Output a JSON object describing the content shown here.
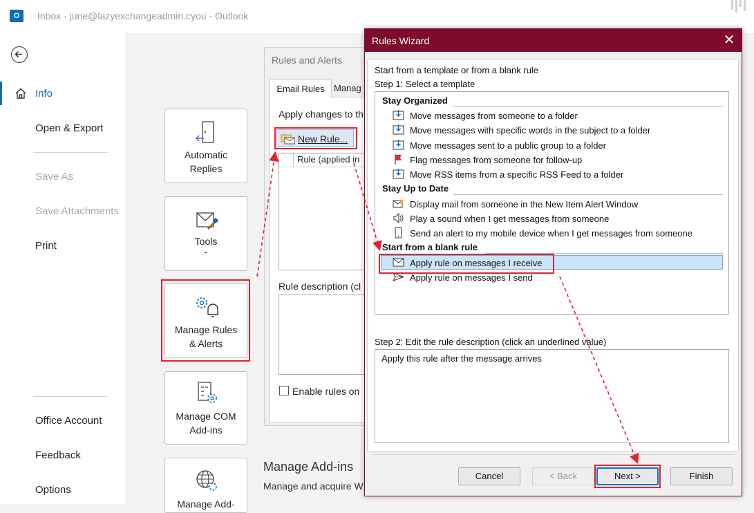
{
  "window": {
    "title": "Inbox - june@lazyexchangeadmin.cyou  -  Outlook",
    "app_icon": "outlook-icon"
  },
  "nav": {
    "info": "Info",
    "open_export": "Open & Export",
    "save_as": "Save As",
    "save_attachments": "Save Attachments",
    "print": "Print",
    "office_account": "Office Account",
    "feedback": "Feedback",
    "options": "Options"
  },
  "tiles": {
    "automatic_replies": [
      "Automatic",
      "Replies"
    ],
    "tools": [
      "Tools",
      "ˇ"
    ],
    "manage_rules": [
      "Manage Rules",
      "& Alerts"
    ],
    "manage_com": [
      "Manage COM",
      "Add-ins"
    ],
    "manage_addins": [
      "Manage Add-"
    ]
  },
  "rules_alerts": {
    "title": "Rules and Alerts",
    "tab_email": "Email Rules",
    "tab_manage": "Manag",
    "apply_text": "Apply changes to th",
    "new_rule": "New Rule...",
    "column": "Rule (applied in",
    "rule_description": "Rule description (cl",
    "enable_rules": "Enable rules on"
  },
  "addins": {
    "heading": "Manage Add-ins",
    "subtext": "Manage and acquire W"
  },
  "wizard": {
    "title": "Rules Wizard",
    "close": "✕",
    "start_text": "Start from a template or from a blank rule",
    "step1": "Step 1: Select a template",
    "groups": {
      "organized": "Stay Organized",
      "uptodate": "Stay Up to Date",
      "blank": "Start from a blank rule"
    },
    "templates": [
      "Move messages from someone to a folder",
      "Move messages with specific words in the subject to a folder",
      "Move messages sent to a public group to a folder",
      "Flag messages from someone for follow-up",
      "Move RSS items from a specific RSS Feed to a folder",
      "Display mail from someone in the New Item Alert Window",
      "Play a sound when I get messages from someone",
      "Send an alert to my mobile device when I get messages from someone",
      "Apply rule on messages I receive",
      "Apply rule on messages I send"
    ],
    "selected_template": "Apply rule on messages I receive",
    "step2": "Step 2: Edit the rule description (click an underlined value)",
    "description": "Apply this rule after the message arrives",
    "buttons": {
      "cancel": "Cancel",
      "back": "< Back",
      "next": "Next >",
      "finish": "Finish"
    }
  },
  "colors": {
    "accent": "#0f6cbd",
    "wizard_title": "#7d0b2b",
    "highlight": "#e2222f",
    "selection": "#cce4f7"
  }
}
